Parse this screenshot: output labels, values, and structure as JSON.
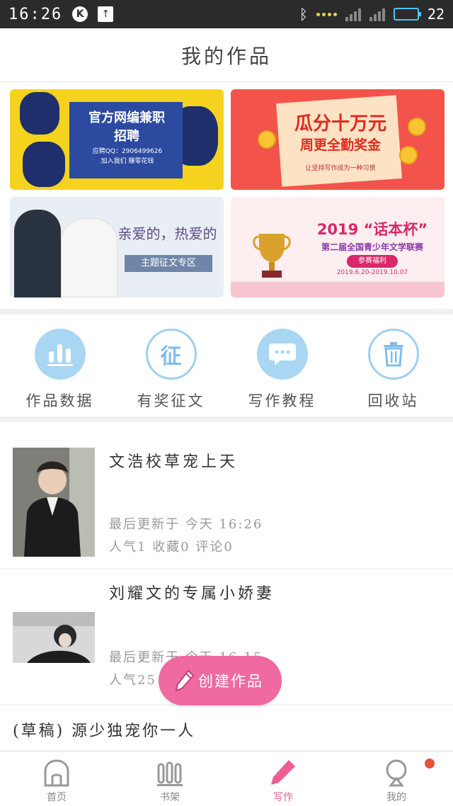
{
  "status_bar": {
    "time": "16:26",
    "battery_text": "22",
    "battery_level": 0.22,
    "k_badge": "K",
    "wifi_label": "WiFi",
    "sim1_label": "×",
    "sim2_label": "×"
  },
  "header": {
    "title": "我的作品"
  },
  "banners": [
    {
      "id": "banner-recruit",
      "line1": "官方网编兼职",
      "line2": "招聘",
      "line3": "应聘QQ：2906499626",
      "line4": "加入我们 赚零花钱"
    },
    {
      "id": "banner-bonus",
      "line1": "瓜分十万元",
      "line2": "周更全勤奖金",
      "line3": "让坚持写作成为一种习惯"
    },
    {
      "id": "banner-contest-theme",
      "line1": "亲爱的，热爱的",
      "line2": "主题征文专区"
    },
    {
      "id": "banner-contest-2019",
      "line1": "2019 “话本杯”",
      "line2": "第二届全国青少年文学联赛",
      "line3": "参赛福利",
      "line4": "2019.6.20-2019.10.07"
    }
  ],
  "tools": [
    {
      "label": "作品数据",
      "icon": "bar-chart-icon"
    },
    {
      "label": "有奖征文",
      "icon": "contest-icon",
      "glyph": "征"
    },
    {
      "label": "写作教程",
      "icon": "tutorial-chat-icon"
    },
    {
      "label": "回收站",
      "icon": "trash-icon"
    }
  ],
  "works": [
    {
      "title": "文浩校草宠上天",
      "updated": "最后更新于 今天 16:26",
      "stats": "人气1 收藏0 评论0"
    },
    {
      "title": "刘耀文的专属小娇妻",
      "updated": "最后更新于 今天 16:15",
      "stats": "人气25"
    }
  ],
  "draft": {
    "title": "(草稿) 源少独宠你一人"
  },
  "fab": {
    "label": "创建作品"
  },
  "tabbar": [
    {
      "label": "首页",
      "icon": "home-icon",
      "active": false
    },
    {
      "label": "书架",
      "icon": "bookshelf-icon",
      "active": false
    },
    {
      "label": "写作",
      "icon": "pencil-icon",
      "active": true
    },
    {
      "label": "我的",
      "icon": "profile-icon",
      "active": false
    }
  ],
  "colors": {
    "accent": "#ee6aa0",
    "tool_blue": "#a9d6f2",
    "status_bar": "#2b2b2b"
  }
}
